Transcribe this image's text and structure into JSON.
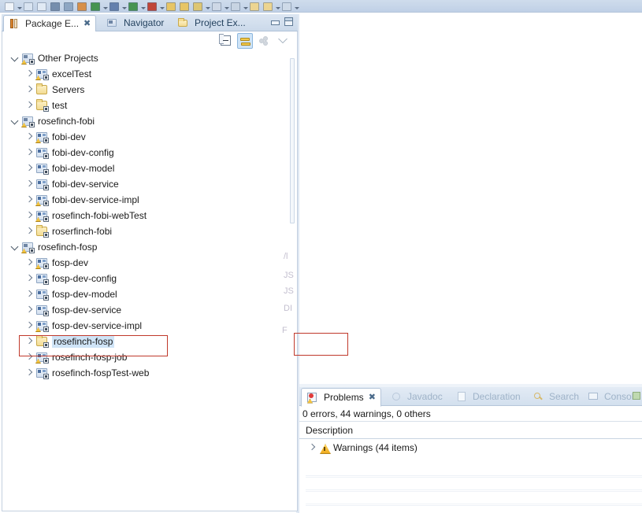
{
  "toolbar": {
    "name": "main-toolbar",
    "icons": [
      {
        "name": "new-icon",
        "color": "#f4f7fb"
      },
      {
        "name": "dropdown-arrow-icon",
        "color": ""
      },
      {
        "name": "save-icon",
        "color": "#dbe6f2"
      },
      {
        "name": "save-all-icon",
        "color": "#e4ecf6"
      },
      {
        "name": "print-icon",
        "color": "#6f88a8"
      },
      {
        "name": "search-icon",
        "color": "#8aa3c0"
      },
      {
        "name": "open-type-icon",
        "color": "#d98a3c"
      },
      {
        "name": "run-icon",
        "color": "#3c8f45"
      },
      {
        "name": "dropdown-arrow-icon",
        "color": ""
      },
      {
        "name": "debug-icon",
        "color": "#5c79a8"
      },
      {
        "name": "dropdown-arrow-icon",
        "color": ""
      },
      {
        "name": "coverage-icon",
        "color": "#3c8f45"
      },
      {
        "name": "dropdown-arrow-icon",
        "color": ""
      },
      {
        "name": "profile-icon",
        "color": "#c0392b"
      },
      {
        "name": "dropdown-arrow-icon",
        "color": ""
      },
      {
        "name": "open-folder-icon",
        "color": "#eac45c"
      },
      {
        "name": "folder-icon",
        "color": "#eac45c"
      },
      {
        "name": "tools-icon",
        "color": "#e0c56a"
      },
      {
        "name": "dropdown-arrow-icon",
        "color": ""
      },
      {
        "name": "table-icon",
        "color": "#cfd9e6"
      },
      {
        "name": "dropdown-arrow-icon",
        "color": ""
      },
      {
        "name": "help-icon",
        "color": "#c8d4e2"
      },
      {
        "name": "dropdown-arrow-icon",
        "color": ""
      },
      {
        "name": "annotation-icon",
        "color": "#f0d58a"
      },
      {
        "name": "annotation-next-icon",
        "color": "#f0d58a"
      },
      {
        "name": "dropdown-arrow-icon",
        "color": ""
      },
      {
        "name": "console-icon",
        "color": "#cfdbe8"
      },
      {
        "name": "dropdown-arrow-icon",
        "color": ""
      }
    ]
  },
  "left_view": {
    "tabs": [
      {
        "label": "Package E...",
        "icon": "package-explorer-icon",
        "active": true,
        "closable": true
      },
      {
        "label": "Navigator",
        "icon": "navigator-icon",
        "active": false,
        "closable": false
      },
      {
        "label": "Project Ex...",
        "icon": "project-explorer-icon",
        "active": false,
        "closable": false
      }
    ],
    "window_buttons": [
      {
        "name": "minimize-button",
        "label": "minimize"
      },
      {
        "name": "maximize-button",
        "label": "maximize"
      }
    ],
    "view_toolbar": [
      {
        "name": "collapse-all-button",
        "label": "Collapse All",
        "active": false
      },
      {
        "name": "link-with-editor-button",
        "label": "Link with Editor",
        "active": true
      },
      {
        "name": "focus-on-active-task-button",
        "label": "Focus on Active Task",
        "active": false
      },
      {
        "name": "view-menu-button",
        "label": "View Menu",
        "active": false
      }
    ],
    "tree": [
      {
        "label": "Other Projects",
        "level": 0,
        "state": "expanded",
        "icon": "working-set-icon",
        "warning": true,
        "decorated": true,
        "selected": false
      },
      {
        "label": "excelTest",
        "level": 1,
        "state": "collapsed",
        "icon": "java-project-icon",
        "warning": true,
        "decorated": true,
        "selected": false
      },
      {
        "label": "Servers",
        "level": 1,
        "state": "collapsed",
        "icon": "folder-project-icon",
        "warning": false,
        "decorated": false,
        "selected": false
      },
      {
        "label": "test",
        "level": 1,
        "state": "collapsed",
        "icon": "folder-project-icon",
        "warning": false,
        "decorated": true,
        "selected": false
      },
      {
        "label": "rosefinch-fobi",
        "level": 0,
        "state": "expanded",
        "icon": "maven-project-icon",
        "warning": true,
        "decorated": true,
        "selected": false
      },
      {
        "label": "fobi-dev",
        "level": 1,
        "state": "collapsed",
        "icon": "java-project-icon",
        "warning": true,
        "decorated": true,
        "selected": false
      },
      {
        "label": "fobi-dev-config",
        "level": 1,
        "state": "collapsed",
        "icon": "java-project-icon",
        "warning": false,
        "decorated": true,
        "selected": false
      },
      {
        "label": "fobi-dev-model",
        "level": 1,
        "state": "collapsed",
        "icon": "java-project-icon",
        "warning": false,
        "decorated": true,
        "selected": false
      },
      {
        "label": "fobi-dev-service",
        "level": 1,
        "state": "collapsed",
        "icon": "java-project-icon",
        "warning": false,
        "decorated": true,
        "selected": false
      },
      {
        "label": "fobi-dev-service-impl",
        "level": 1,
        "state": "collapsed",
        "icon": "java-project-icon",
        "warning": true,
        "decorated": true,
        "selected": false
      },
      {
        "label": "rosefinch-fobi-webTest",
        "level": 1,
        "state": "collapsed",
        "icon": "java-project-icon",
        "warning": true,
        "decorated": true,
        "selected": false
      },
      {
        "label": "roserfinch-fobi",
        "level": 1,
        "state": "collapsed",
        "icon": "folder-project-icon",
        "warning": false,
        "decorated": true,
        "selected": false
      },
      {
        "label": "rosefinch-fosp",
        "level": 0,
        "state": "expanded",
        "icon": "maven-project-icon",
        "warning": true,
        "decorated": true,
        "selected": false
      },
      {
        "label": "fosp-dev",
        "level": 1,
        "state": "collapsed",
        "icon": "java-project-icon",
        "warning": true,
        "decorated": true,
        "selected": false
      },
      {
        "label": "fosp-dev-config",
        "level": 1,
        "state": "collapsed",
        "icon": "java-project-icon",
        "warning": false,
        "decorated": true,
        "selected": false
      },
      {
        "label": "fosp-dev-model",
        "level": 1,
        "state": "collapsed",
        "icon": "java-project-icon",
        "warning": false,
        "decorated": true,
        "selected": false
      },
      {
        "label": "fosp-dev-service",
        "level": 1,
        "state": "collapsed",
        "icon": "java-project-icon",
        "warning": false,
        "decorated": true,
        "selected": false
      },
      {
        "label": "fosp-dev-service-impl",
        "level": 1,
        "state": "collapsed",
        "icon": "java-project-icon",
        "warning": true,
        "decorated": true,
        "selected": false
      },
      {
        "label": "rosefinch-fosp",
        "level": 1,
        "state": "collapsed",
        "icon": "folder-project-icon",
        "warning": false,
        "decorated": true,
        "selected": true
      },
      {
        "label": "rosefinch-fosp-job",
        "level": 1,
        "state": "collapsed",
        "icon": "java-project-icon",
        "warning": true,
        "decorated": true,
        "selected": false
      },
      {
        "label": "rosefinch-fospTest-web",
        "level": 1,
        "state": "collapsed",
        "icon": "java-project-icon",
        "warning": false,
        "decorated": true,
        "selected": false
      }
    ]
  },
  "editor_area": {
    "ghost_text": [
      "/l",
      "JS",
      "JS",
      "DI",
      "F"
    ]
  },
  "bottom_view": {
    "tabs": [
      {
        "label": "Problems",
        "icon": "problems-icon",
        "active": true,
        "closable": true
      },
      {
        "label": "Javadoc",
        "icon": "javadoc-icon",
        "active": false,
        "closable": false
      },
      {
        "label": "Declaration",
        "icon": "declaration-icon",
        "active": false,
        "closable": false
      },
      {
        "label": "Search",
        "icon": "search-icon",
        "active": false,
        "closable": false
      },
      {
        "label": "Console",
        "icon": "console-icon",
        "active": false,
        "closable": false
      }
    ],
    "summary": "0 errors, 44 warnings, 0 others",
    "column_header": "Description",
    "rows": [
      {
        "label": "Warnings (44 items)",
        "icon": "warning-icon",
        "state": "collapsed"
      }
    ]
  },
  "annotations": [
    {
      "name": "highlight-box-selected-project",
      "color": "#c0392b"
    },
    {
      "name": "highlight-box-editor-region",
      "color": "#c0392b"
    }
  ]
}
